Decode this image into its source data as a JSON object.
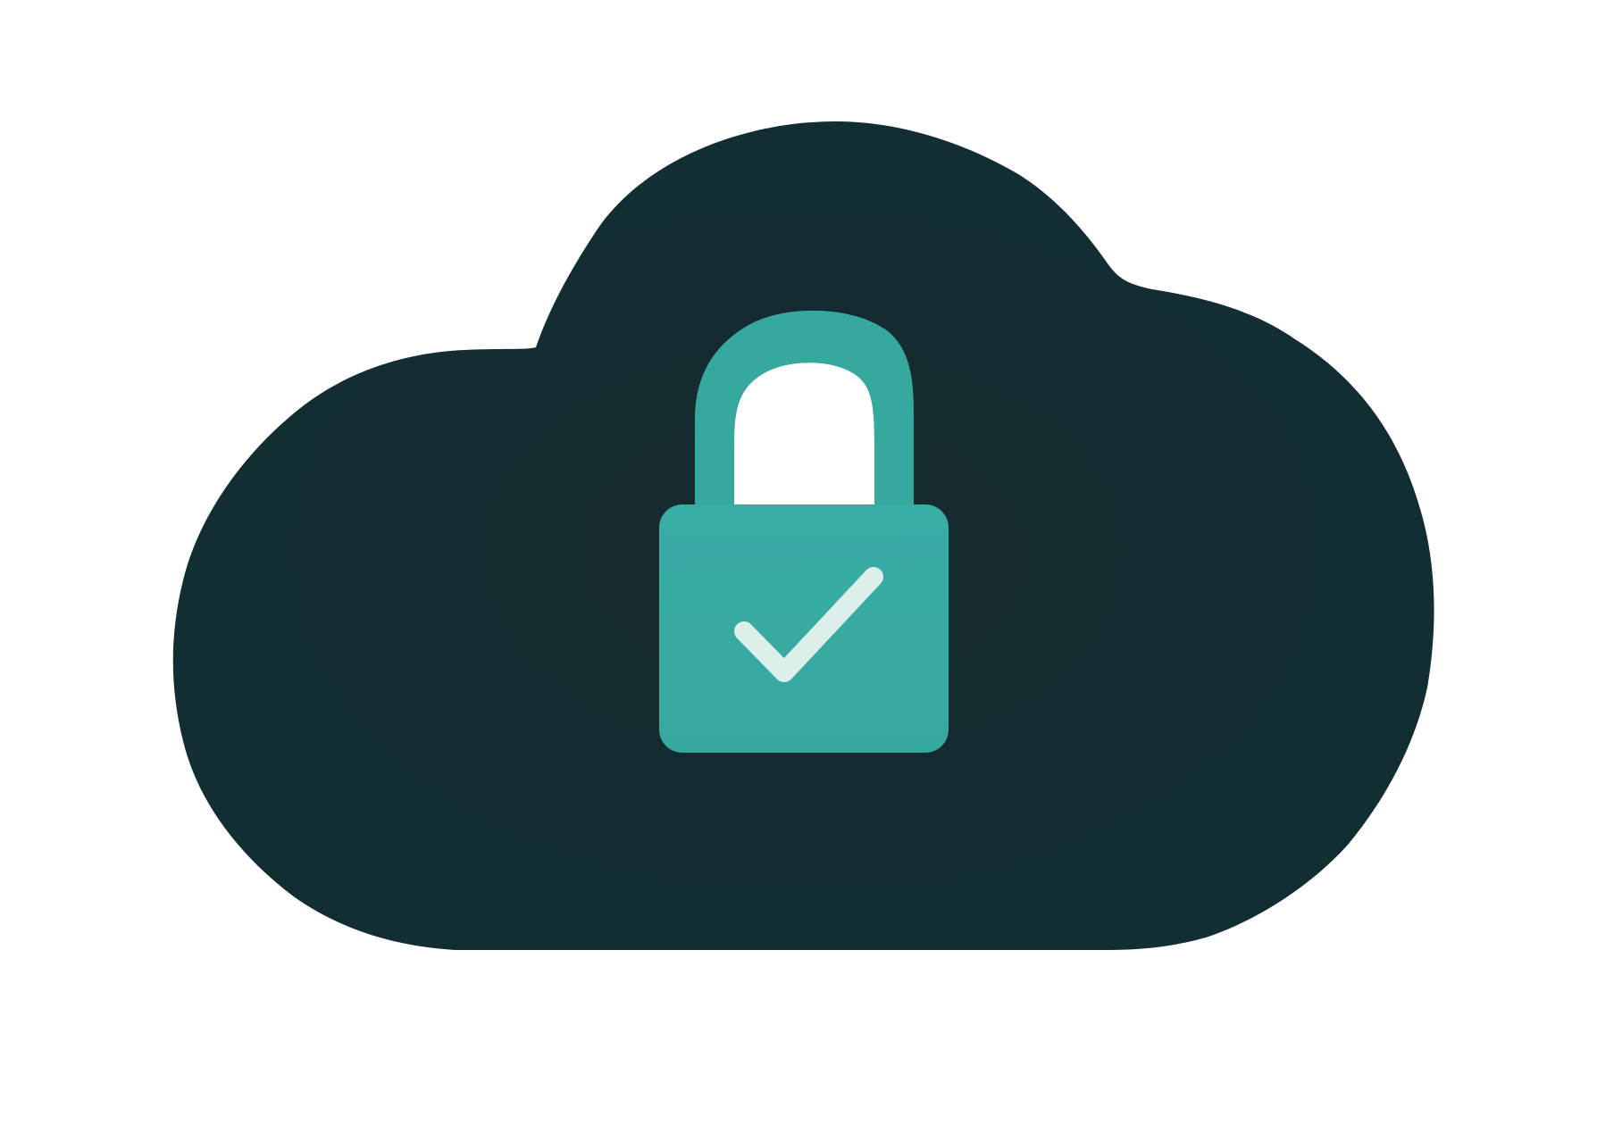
{
  "illustration": {
    "icon_names": [
      "cloud-icon",
      "padlock-icon",
      "checkmark-icon"
    ],
    "colors": {
      "background": "#ffffff",
      "cloud": "#122e33",
      "lock_body": "#38ada5",
      "lock_shackle": "#36a99f",
      "shackle_inner": "#ffffff",
      "check": "#dcefea"
    }
  }
}
